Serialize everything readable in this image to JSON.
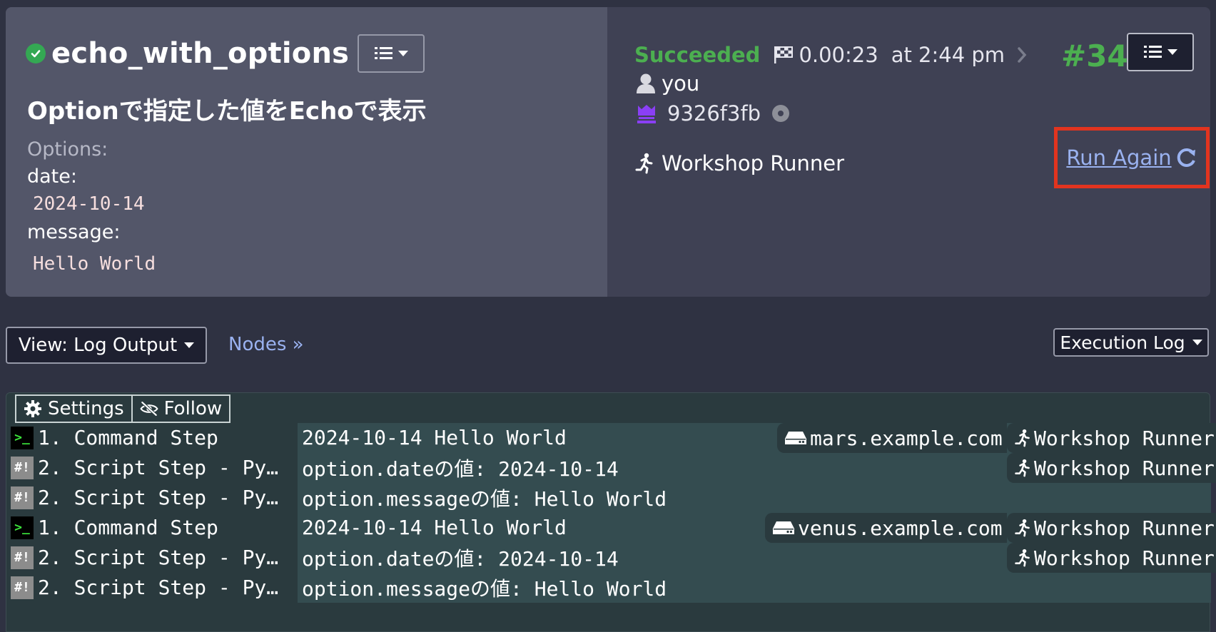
{
  "job": {
    "title": "echo_with_options",
    "description": "Optionで指定した値をEchoで表示",
    "options_label": "Options:",
    "options": [
      {
        "name": "date:",
        "value": "2024-10-14"
      },
      {
        "name": "message:",
        "value": "Hello World"
      }
    ]
  },
  "execution": {
    "status": "Succeeded",
    "duration": "0.00:23",
    "time": "at 2:44 pm",
    "number": "#34",
    "user": "you",
    "commit": "9326f3fb",
    "runner": "Workshop Runner",
    "run_again_label": "Run Again"
  },
  "toolbar": {
    "view_label": "View: Log Output",
    "nodes_label": "Nodes »",
    "exec_log_label": "Execution Log"
  },
  "log": {
    "settings_label": "Settings",
    "follow_label": "Follow",
    "rows": [
      {
        "badge": ">_",
        "step": "1. Command Step",
        "message": "2024-10-14 Hello World",
        "node": "mars.example.com",
        "runner": "Workshop Runner"
      },
      {
        "badge": "#!",
        "step": "2. Script Step - Py…",
        "message": "option.dateの値: 2024-10-14",
        "node": "",
        "runner": "Workshop Runner"
      },
      {
        "badge": "#!",
        "step": "2. Script Step - Py…",
        "message": "option.messageの値: Hello World",
        "node": "",
        "runner": ""
      },
      {
        "badge": ">_",
        "step": "1. Command Step",
        "message": "2024-10-14 Hello World",
        "node": "venus.example.com",
        "runner": "Workshop Runner"
      },
      {
        "badge": "#!",
        "step": "2. Script Step - Py…",
        "message": "option.dateの値: 2024-10-14",
        "node": "",
        "runner": "Workshop Runner"
      },
      {
        "badge": "#!",
        "step": "2. Script Step - Py…",
        "message": "option.messageの値: Hello World",
        "node": "",
        "runner": ""
      }
    ]
  },
  "colors": {
    "success": "#4caf50",
    "link": "#9ab2f0",
    "highlight_box": "#e2341f"
  }
}
